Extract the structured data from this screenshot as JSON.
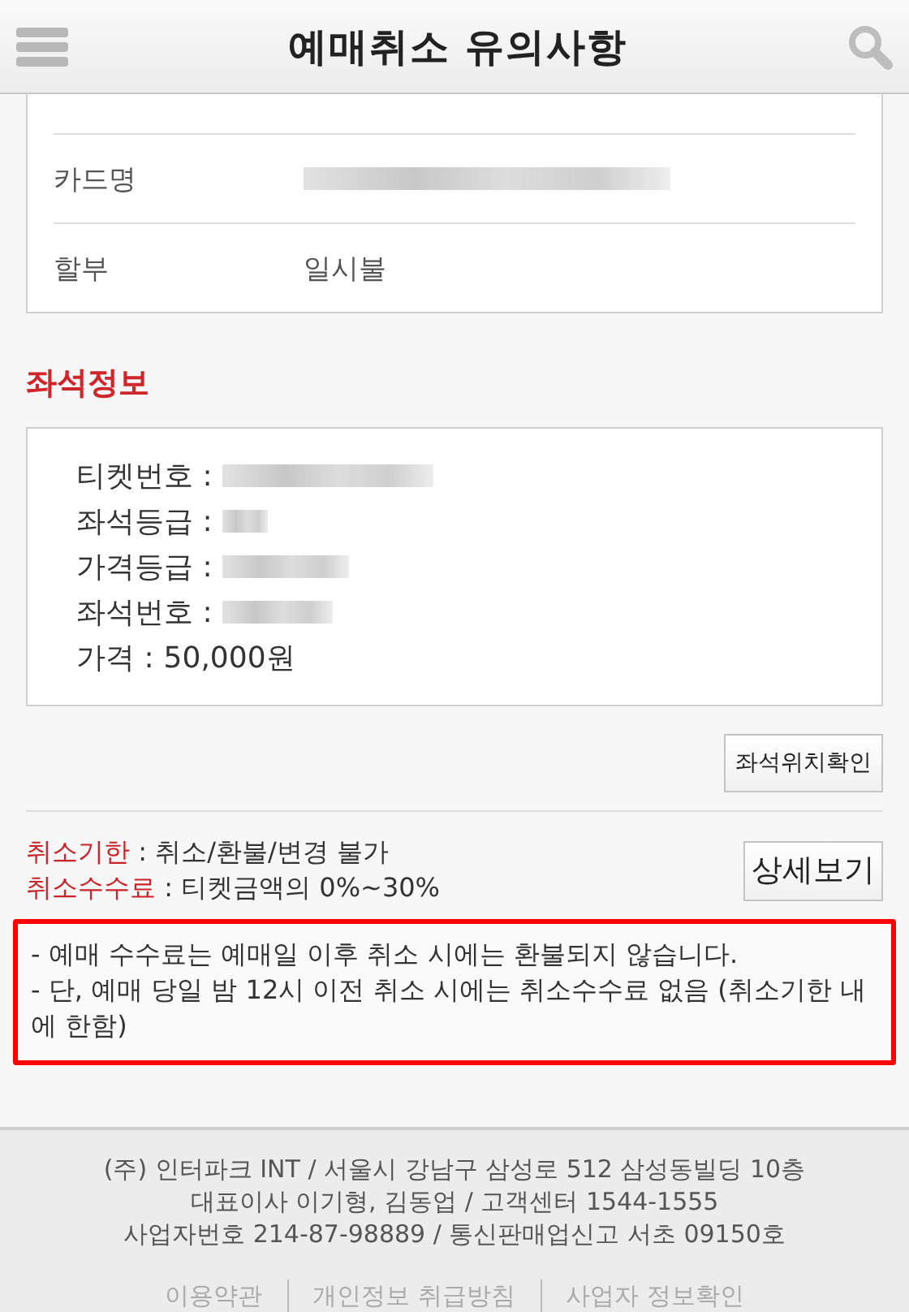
{
  "header": {
    "title": "예매취소 유의사항"
  },
  "payment_rows": [
    {
      "label": "카드명",
      "redacted": true
    },
    {
      "label": "할부",
      "value": "일시불",
      "redacted": false
    }
  ],
  "seat_section": {
    "title": "좌석정보",
    "lines": [
      {
        "label": "티켓번호 :",
        "redacted": true
      },
      {
        "label": "좌석등급 :",
        "redacted": true
      },
      {
        "label": "가격등급 :",
        "redacted": true
      },
      {
        "label": "좌석번호 :",
        "redacted": true
      },
      {
        "label": "가격 :",
        "value": "50,000원",
        "redacted": false
      }
    ],
    "map_button": "좌석위치확인"
  },
  "cancel_info": [
    {
      "label": "취소기한",
      "value": ": 취소/환불/변경 불가"
    },
    {
      "label": "취소수수료",
      "value": ": 티켓금액의 0%~30%"
    }
  ],
  "detail_button": "상세보기",
  "notices": [
    "- 예매 수수료는 예매일 이후 취소 시에는 환불되지 않습니다.",
    "- 단, 예매 당일 밤 12시 이전 취소 시에는 취소수수료 없음 (취소기한 내에 한함)"
  ],
  "footer": {
    "lines": [
      "(주) 인터파크 INT / 서울시 강남구 삼성로 512 삼성동빌딩 10층",
      "대표이사 이기형, 김동업 / 고객센터 1544-1555",
      "사업자번호 214-87-98889 / 통신판매업신고 서초 09150호"
    ],
    "links": [
      "이용약관",
      "개인정보 취급방침",
      "사업자 정보확인"
    ]
  }
}
